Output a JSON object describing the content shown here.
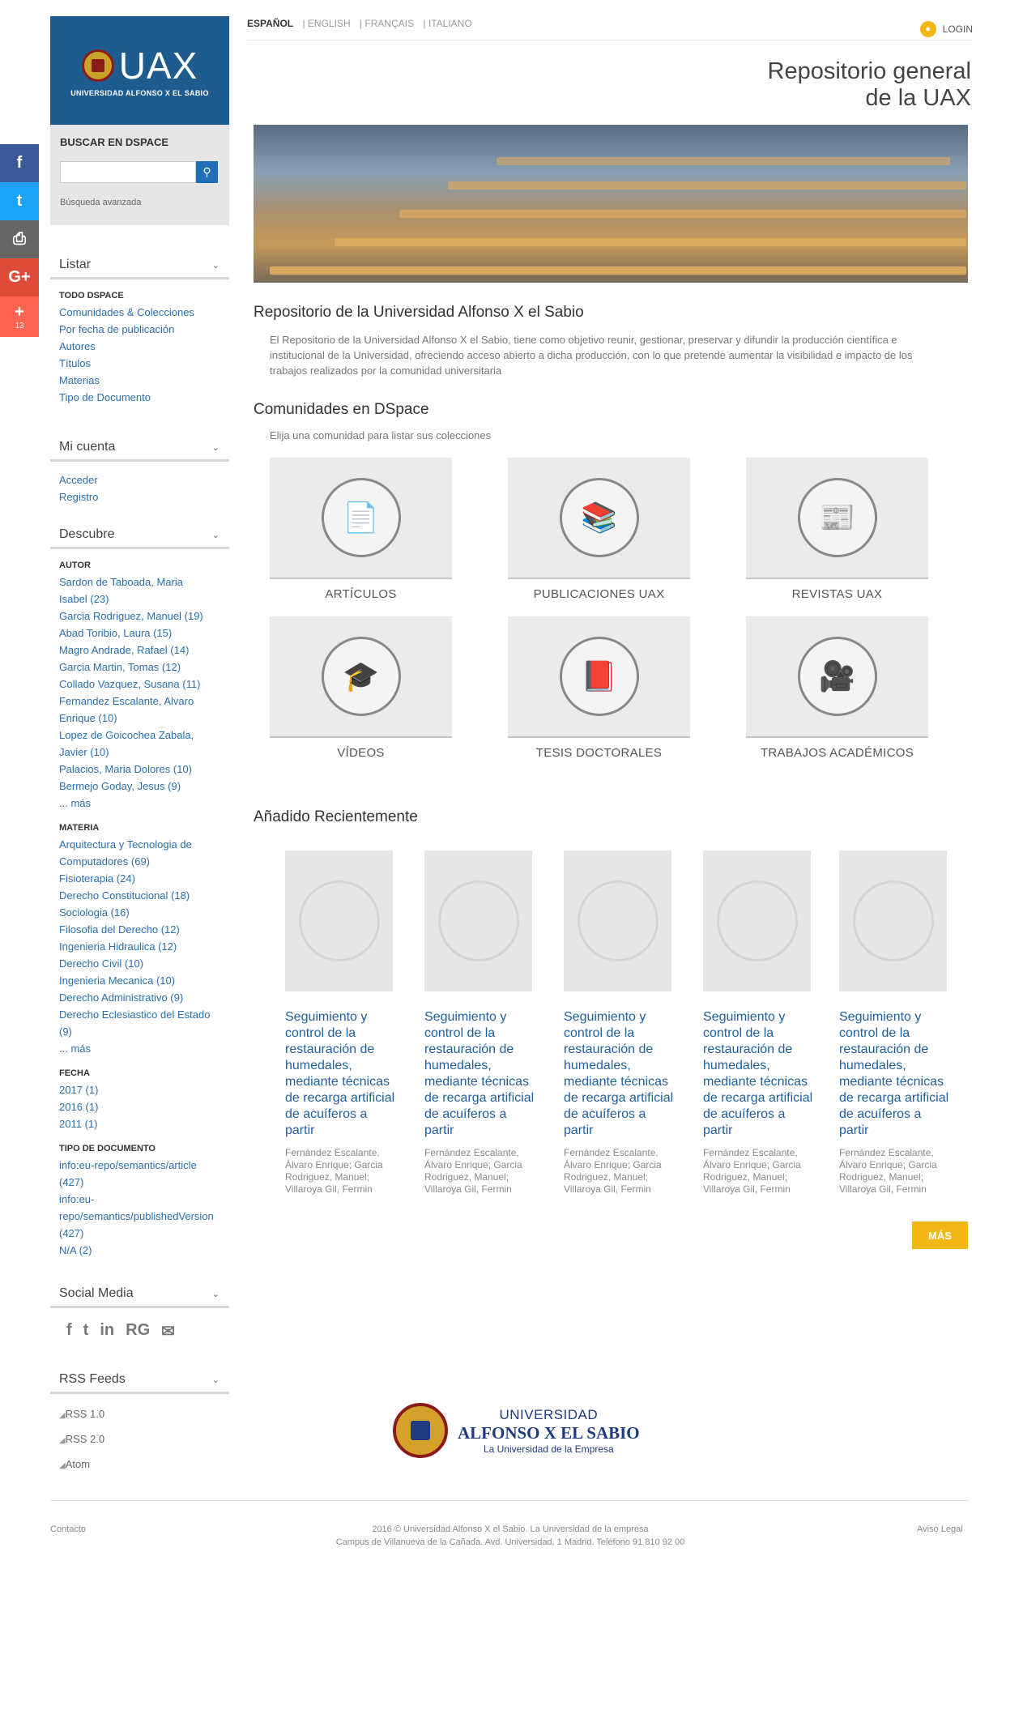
{
  "share": {
    "plus_count": "13"
  },
  "logo": {
    "text": "UAX",
    "subtitle": "UNIVERSIDAD ALFONSO X EL SABIO"
  },
  "search": {
    "title": "BUSCAR EN DSPACE",
    "advanced": "Búsqueda avanzada"
  },
  "browse": {
    "title": "Listar",
    "category": "TODO DSPACE",
    "items": [
      "Comunidades & Colecciones",
      "Por fecha de publicación",
      "Autores",
      "Títulos",
      "Materias",
      "Tipo de Documento"
    ]
  },
  "account": {
    "title": "Mi cuenta",
    "items": [
      "Acceder",
      "Registro"
    ]
  },
  "discover": {
    "title": "Descubre",
    "author": {
      "label": "AUTOR",
      "items": [
        "Sardon de Taboada, Maria Isabel (23)",
        "Garcia Rodriguez, Manuel (19)",
        "Abad Toribio, Laura (15)",
        "Magro Andrade, Rafael (14)",
        "Garcia Martin, Tomas (12)",
        "Collado Vazquez, Susana (11)",
        "Fernandez Escalante, Alvaro Enrique (10)",
        "Lopez de Goicochea Zabala, Javier (10)",
        "Palacios, Maria Dolores (10)",
        "Bermejo Goday, Jesus (9)",
        "... más"
      ]
    },
    "subject": {
      "label": "MATERIA",
      "items": [
        "Arquitectura y Tecnologia de Computadores (69)",
        "Fisioterapia (24)",
        "Derecho Constitucional (18)",
        "Sociologia (16)",
        "Filosofia del Derecho (12)",
        "Ingenieria Hidraulica (12)",
        "Derecho Civil (10)",
        "Ingenieria Mecanica (10)",
        "Derecho Administrativo (9)",
        "Derecho Eclesiastico del Estado (9)",
        "... más"
      ]
    },
    "date": {
      "label": "FECHA",
      "items": [
        "2017 (1)",
        "2016 (1)",
        "2011 (1)"
      ]
    },
    "doctype": {
      "label": "TIPO DE DOCUMENTO",
      "items": [
        "info:eu-repo/semantics/article (427)",
        "info:eu-repo/semantics/publishedVersion (427)",
        "N/A (2)"
      ]
    }
  },
  "social": {
    "title": "Social Media",
    "icons": [
      "f",
      "t",
      "in",
      "RG",
      "✉"
    ]
  },
  "rss": {
    "title": "RSS Feeds",
    "items": [
      "RSS 1.0",
      "RSS 2.0",
      "Atom"
    ]
  },
  "lang": {
    "items": [
      "ESPAÑOL",
      "ENGLISH",
      "FRANÇAIS",
      "ITALIANO"
    ],
    "login": "LOGIN"
  },
  "header": {
    "line1": "Repositorio general",
    "line2": "de la UAX"
  },
  "intro": {
    "title": "Repositorio de la Universidad Alfonso X el Sabio",
    "text": "El Repositorio de la Universidad Alfonso X el Sabio, tiene como objetivo reunir, gestionar, preservar y difundir la producción científica e institucional de la Universidad, ofreciendo acceso abierto a dicha producción, con lo que pretende aumentar la visibilidad e impacto de los trabajos realizados por la comunidad universitaria"
  },
  "communities": {
    "title": "Comunidades en DSpace",
    "subtitle": "Elija una comunidad para listar sus colecciones",
    "items": [
      {
        "label": "ARTÍCULOS",
        "icon": "📄"
      },
      {
        "label": "PUBLICACIONES UAX",
        "icon": "📚"
      },
      {
        "label": "REVISTAS UAX",
        "icon": "📰"
      },
      {
        "label": "VÍDEOS",
        "icon": "🎓"
      },
      {
        "label": "TESIS DOCTORALES",
        "icon": "📕"
      },
      {
        "label": "TRABAJOS ACADÉMICOS",
        "icon": "🎥"
      }
    ]
  },
  "recent": {
    "title": "Añadido Recientemente",
    "more": "MÁS",
    "items": [
      {
        "title": "Seguimiento y control de la restauración de humedales, mediante técnicas de recarga artificial de acuíferos a partir",
        "authors": "Fernández Escalante, Álvaro Enrique; Garcia Rodriguez, Manuel; Villaroya Gil, Fermin"
      },
      {
        "title": "Seguimiento y control de la restauración de humedales, mediante técnicas de recarga artificial de acuíferos a partir",
        "authors": "Fernández Escalante, Álvaro Enrique; Garcia Rodriguez, Manuel; Villaroya Gil, Fermin"
      },
      {
        "title": "Seguimiento y control de la restauración de humedales, mediante técnicas de recarga artificial de acuíferos a partir",
        "authors": "Fernández Escalante, Álvaro Enrique; Garcia Rodriguez, Manuel; Villaroya Gil, Fermin"
      },
      {
        "title": "Seguimiento y control de la restauración de humedales, mediante técnicas de recarga artificial de acuíferos a partir",
        "authors": "Fernández Escalante, Álvaro Enrique; Garcia Rodriguez, Manuel; Villaroya Gil, Fermin"
      },
      {
        "title": "Seguimiento y control de la restauración de humedales, mediante técnicas de recarga artificial de acuíferos a partir",
        "authors": "Fernández Escalante, Álvaro Enrique; Garcia Rodriguez, Manuel; Villaroya Gil, Fermin"
      }
    ]
  },
  "footer_logo": {
    "l1": "UNIVERSIDAD",
    "l2": "ALFONSO X EL SABIO",
    "l3": "La Universidad de la Empresa"
  },
  "footer": {
    "contact": "Contacto",
    "copy1": "2016 © Universidad Alfonso X el Sabio. La Universidad de la empresa",
    "copy2": "Campus de Villanueva de la Cañada. Avd. Universidad, 1 Madrid. Teléfono 91 810 92 00",
    "legal": "Aviso Legal"
  }
}
